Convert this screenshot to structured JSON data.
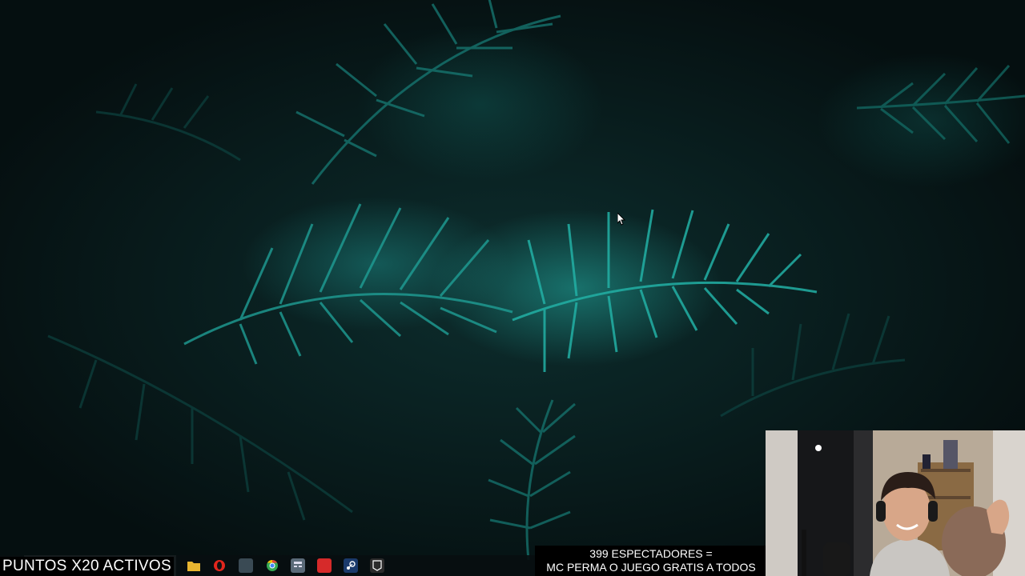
{
  "desktop": {
    "wallpaper": "fern-leaves",
    "accent_color": "#1fb7ad"
  },
  "taskbar": {
    "icons": [
      {
        "name": "file-explorer-icon",
        "color": "#e8b530"
      },
      {
        "name": "opera-icon",
        "color": "#e2261d"
      },
      {
        "name": "app-icon",
        "color": "#3a4a54"
      },
      {
        "name": "chrome-icon",
        "color": "#4285f4"
      },
      {
        "name": "calculator-icon",
        "color": "#5a6a78"
      },
      {
        "name": "red-app-icon",
        "color": "#d62a2a"
      },
      {
        "name": "steam-icon",
        "color": "#1b3a6b"
      },
      {
        "name": "epic-games-icon",
        "color": "#2b2b2b"
      }
    ]
  },
  "overlay": {
    "puntos": "PUNTOS X20 ACTIVOS",
    "viewers_line1": "399 ESPECTADORES =",
    "viewers_line2": "MC PERMA O JUEGO GRATIS A TODOS"
  }
}
